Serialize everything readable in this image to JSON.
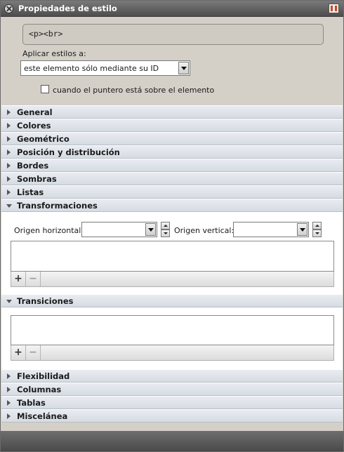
{
  "window": {
    "title": "Propiedades de estilo",
    "close_icon": "close-icon",
    "dock_icon": "dock-panel-icon"
  },
  "selector": {
    "text": "<p><br>",
    "apply_label": "Aplicar estilos a:",
    "apply_value": "este elemento sólo mediante su ID",
    "hover_checkbox_label": "cuando el puntero está sobre el elemento",
    "hover_checked": false
  },
  "sections": {
    "general": "General",
    "colores": "Colores",
    "geometrico": "Geométrico",
    "posicion": "Posición y distribución",
    "bordes": "Bordes",
    "sombras": "Sombras",
    "listas": "Listas",
    "transformaciones": "Transformaciones",
    "transiciones": "Transiciones",
    "flexibilidad": "Flexibilidad",
    "columnas": "Columnas",
    "tablas": "Tablas",
    "miscelanea": "Miscelánea"
  },
  "transform": {
    "origin_h_label": "Origen horizontal:",
    "origin_h_value": "",
    "origin_v_label": "Origen vertical:",
    "origin_v_value": ""
  },
  "toolbar": {
    "add_label": "+",
    "remove_label": "−"
  }
}
